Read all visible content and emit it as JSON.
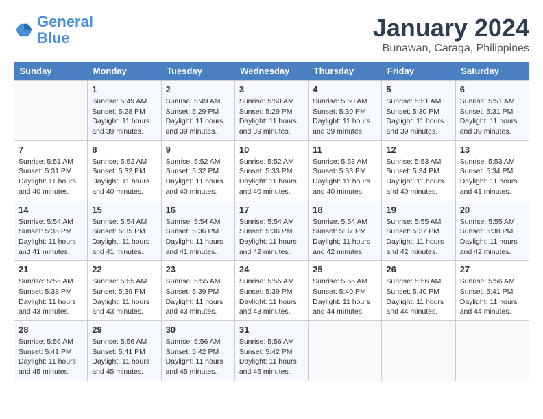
{
  "header": {
    "logo_line1": "General",
    "logo_line2": "Blue",
    "month": "January 2024",
    "location": "Bunawan, Caraga, Philippines"
  },
  "days_of_week": [
    "Sunday",
    "Monday",
    "Tuesday",
    "Wednesday",
    "Thursday",
    "Friday",
    "Saturday"
  ],
  "weeks": [
    [
      {
        "day": "",
        "info": ""
      },
      {
        "day": "1",
        "info": "Sunrise: 5:49 AM\nSunset: 5:28 PM\nDaylight: 11 hours\nand 39 minutes."
      },
      {
        "day": "2",
        "info": "Sunrise: 5:49 AM\nSunset: 5:29 PM\nDaylight: 11 hours\nand 39 minutes."
      },
      {
        "day": "3",
        "info": "Sunrise: 5:50 AM\nSunset: 5:29 PM\nDaylight: 11 hours\nand 39 minutes."
      },
      {
        "day": "4",
        "info": "Sunrise: 5:50 AM\nSunset: 5:30 PM\nDaylight: 11 hours\nand 39 minutes."
      },
      {
        "day": "5",
        "info": "Sunrise: 5:51 AM\nSunset: 5:30 PM\nDaylight: 11 hours\nand 39 minutes."
      },
      {
        "day": "6",
        "info": "Sunrise: 5:51 AM\nSunset: 5:31 PM\nDaylight: 11 hours\nand 39 minutes."
      }
    ],
    [
      {
        "day": "7",
        "info": "Sunrise: 5:51 AM\nSunset: 5:31 PM\nDaylight: 11 hours\nand 40 minutes."
      },
      {
        "day": "8",
        "info": "Sunrise: 5:52 AM\nSunset: 5:32 PM\nDaylight: 11 hours\nand 40 minutes."
      },
      {
        "day": "9",
        "info": "Sunrise: 5:52 AM\nSunset: 5:32 PM\nDaylight: 11 hours\nand 40 minutes."
      },
      {
        "day": "10",
        "info": "Sunrise: 5:52 AM\nSunset: 5:33 PM\nDaylight: 11 hours\nand 40 minutes."
      },
      {
        "day": "11",
        "info": "Sunrise: 5:53 AM\nSunset: 5:33 PM\nDaylight: 11 hours\nand 40 minutes."
      },
      {
        "day": "12",
        "info": "Sunrise: 5:53 AM\nSunset: 5:34 PM\nDaylight: 11 hours\nand 40 minutes."
      },
      {
        "day": "13",
        "info": "Sunrise: 5:53 AM\nSunset: 5:34 PM\nDaylight: 11 hours\nand 41 minutes."
      }
    ],
    [
      {
        "day": "14",
        "info": "Sunrise: 5:54 AM\nSunset: 5:35 PM\nDaylight: 11 hours\nand 41 minutes."
      },
      {
        "day": "15",
        "info": "Sunrise: 5:54 AM\nSunset: 5:35 PM\nDaylight: 11 hours\nand 41 minutes."
      },
      {
        "day": "16",
        "info": "Sunrise: 5:54 AM\nSunset: 5:36 PM\nDaylight: 11 hours\nand 41 minutes."
      },
      {
        "day": "17",
        "info": "Sunrise: 5:54 AM\nSunset: 5:36 PM\nDaylight: 11 hours\nand 42 minutes."
      },
      {
        "day": "18",
        "info": "Sunrise: 5:54 AM\nSunset: 5:37 PM\nDaylight: 11 hours\nand 42 minutes."
      },
      {
        "day": "19",
        "info": "Sunrise: 5:55 AM\nSunset: 5:37 PM\nDaylight: 11 hours\nand 42 minutes."
      },
      {
        "day": "20",
        "info": "Sunrise: 5:55 AM\nSunset: 5:38 PM\nDaylight: 11 hours\nand 42 minutes."
      }
    ],
    [
      {
        "day": "21",
        "info": "Sunrise: 5:55 AM\nSunset: 5:38 PM\nDaylight: 11 hours\nand 43 minutes."
      },
      {
        "day": "22",
        "info": "Sunrise: 5:55 AM\nSunset: 5:39 PM\nDaylight: 11 hours\nand 43 minutes."
      },
      {
        "day": "23",
        "info": "Sunrise: 5:55 AM\nSunset: 5:39 PM\nDaylight: 11 hours\nand 43 minutes."
      },
      {
        "day": "24",
        "info": "Sunrise: 5:55 AM\nSunset: 5:39 PM\nDaylight: 11 hours\nand 43 minutes."
      },
      {
        "day": "25",
        "info": "Sunrise: 5:55 AM\nSunset: 5:40 PM\nDaylight: 11 hours\nand 44 minutes."
      },
      {
        "day": "26",
        "info": "Sunrise: 5:56 AM\nSunset: 5:40 PM\nDaylight: 11 hours\nand 44 minutes."
      },
      {
        "day": "27",
        "info": "Sunrise: 5:56 AM\nSunset: 5:41 PM\nDaylight: 11 hours\nand 44 minutes."
      }
    ],
    [
      {
        "day": "28",
        "info": "Sunrise: 5:56 AM\nSunset: 5:41 PM\nDaylight: 11 hours\nand 45 minutes."
      },
      {
        "day": "29",
        "info": "Sunrise: 5:56 AM\nSunset: 5:41 PM\nDaylight: 11 hours\nand 45 minutes."
      },
      {
        "day": "30",
        "info": "Sunrise: 5:56 AM\nSunset: 5:42 PM\nDaylight: 11 hours\nand 45 minutes."
      },
      {
        "day": "31",
        "info": "Sunrise: 5:56 AM\nSunset: 5:42 PM\nDaylight: 11 hours\nand 46 minutes."
      },
      {
        "day": "",
        "info": ""
      },
      {
        "day": "",
        "info": ""
      },
      {
        "day": "",
        "info": ""
      }
    ]
  ]
}
